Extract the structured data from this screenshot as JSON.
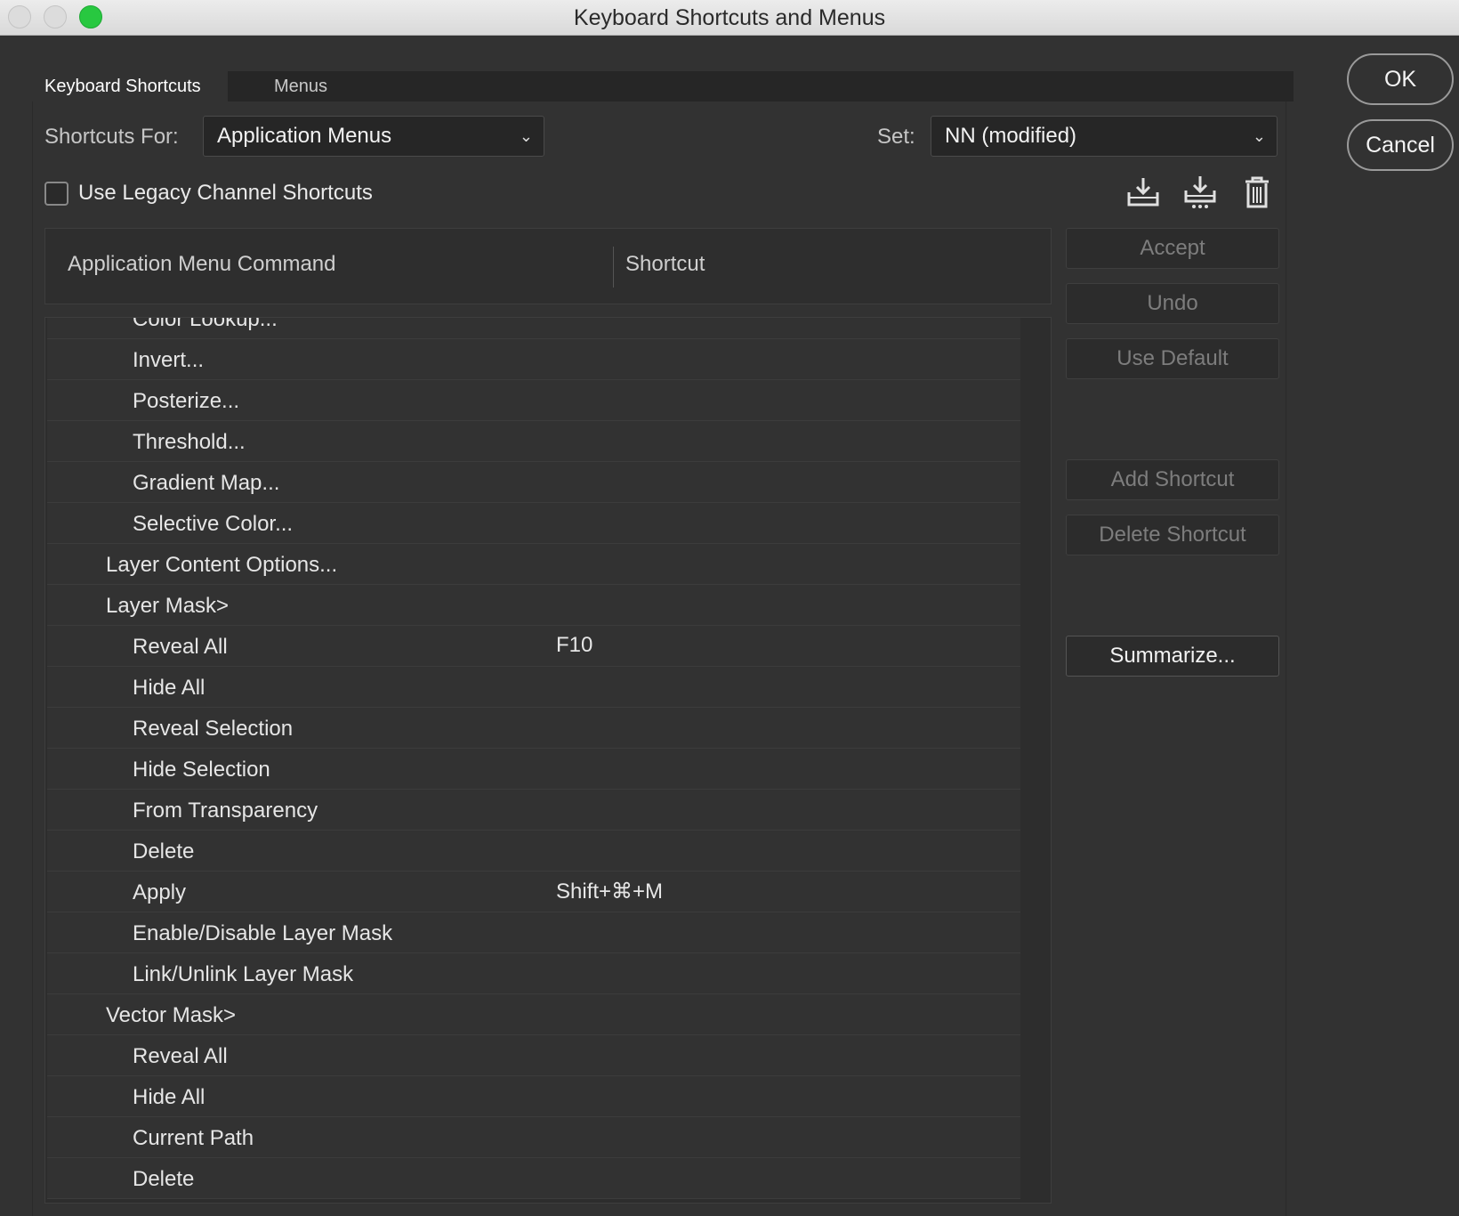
{
  "window": {
    "title": "Keyboard Shortcuts and Menus"
  },
  "tabs": [
    {
      "label": "Keyboard Shortcuts",
      "active": true
    },
    {
      "label": "Menus",
      "active": false
    }
  ],
  "shortcuts_for": {
    "label": "Shortcuts For:",
    "value": "Application Menus"
  },
  "set": {
    "label": "Set:",
    "value": "NN (modified)"
  },
  "legacy_channel": {
    "label": "Use Legacy Channel Shortcuts",
    "checked": false
  },
  "toolbar_icons": [
    "save-set-icon",
    "save-set-as-icon",
    "delete-set-icon"
  ],
  "table": {
    "columns": [
      "Application Menu Command",
      "Shortcut"
    ],
    "rows": [
      {
        "cmd": "Color Lookup...",
        "shortcut": "",
        "level": 2
      },
      {
        "cmd": "Invert...",
        "shortcut": "",
        "level": 2
      },
      {
        "cmd": "Posterize...",
        "shortcut": "",
        "level": 2
      },
      {
        "cmd": "Threshold...",
        "shortcut": "",
        "level": 2
      },
      {
        "cmd": "Gradient Map...",
        "shortcut": "",
        "level": 2
      },
      {
        "cmd": "Selective Color...",
        "shortcut": "",
        "level": 2
      },
      {
        "cmd": "Layer Content Options...",
        "shortcut": "",
        "level": 1
      },
      {
        "cmd": "Layer Mask>",
        "shortcut": "",
        "level": 1
      },
      {
        "cmd": "Reveal All",
        "shortcut": "F10",
        "level": 2
      },
      {
        "cmd": "Hide All",
        "shortcut": "",
        "level": 2
      },
      {
        "cmd": "Reveal Selection",
        "shortcut": "",
        "level": 2
      },
      {
        "cmd": "Hide Selection",
        "shortcut": "",
        "level": 2
      },
      {
        "cmd": "From Transparency",
        "shortcut": "",
        "level": 2
      },
      {
        "cmd": "Delete",
        "shortcut": "",
        "level": 2
      },
      {
        "cmd": "Apply",
        "shortcut": "Shift+⌘+M",
        "level": 2
      },
      {
        "cmd": "Enable/Disable Layer Mask",
        "shortcut": "",
        "level": 2
      },
      {
        "cmd": "Link/Unlink Layer Mask",
        "shortcut": "",
        "level": 2
      },
      {
        "cmd": "Vector Mask>",
        "shortcut": "",
        "level": 1
      },
      {
        "cmd": "Reveal All",
        "shortcut": "",
        "level": 2
      },
      {
        "cmd": "Hide All",
        "shortcut": "",
        "level": 2
      },
      {
        "cmd": "Current Path",
        "shortcut": "",
        "level": 2
      },
      {
        "cmd": "Delete",
        "shortcut": "",
        "level": 2
      }
    ]
  },
  "side_buttons": {
    "accept": "Accept",
    "undo": "Undo",
    "use_default": "Use Default",
    "add_shortcut": "Add Shortcut",
    "delete_shortcut": "Delete Shortcut",
    "summarize": "Summarize..."
  },
  "dialog_buttons": {
    "ok": "OK",
    "cancel": "Cancel"
  }
}
